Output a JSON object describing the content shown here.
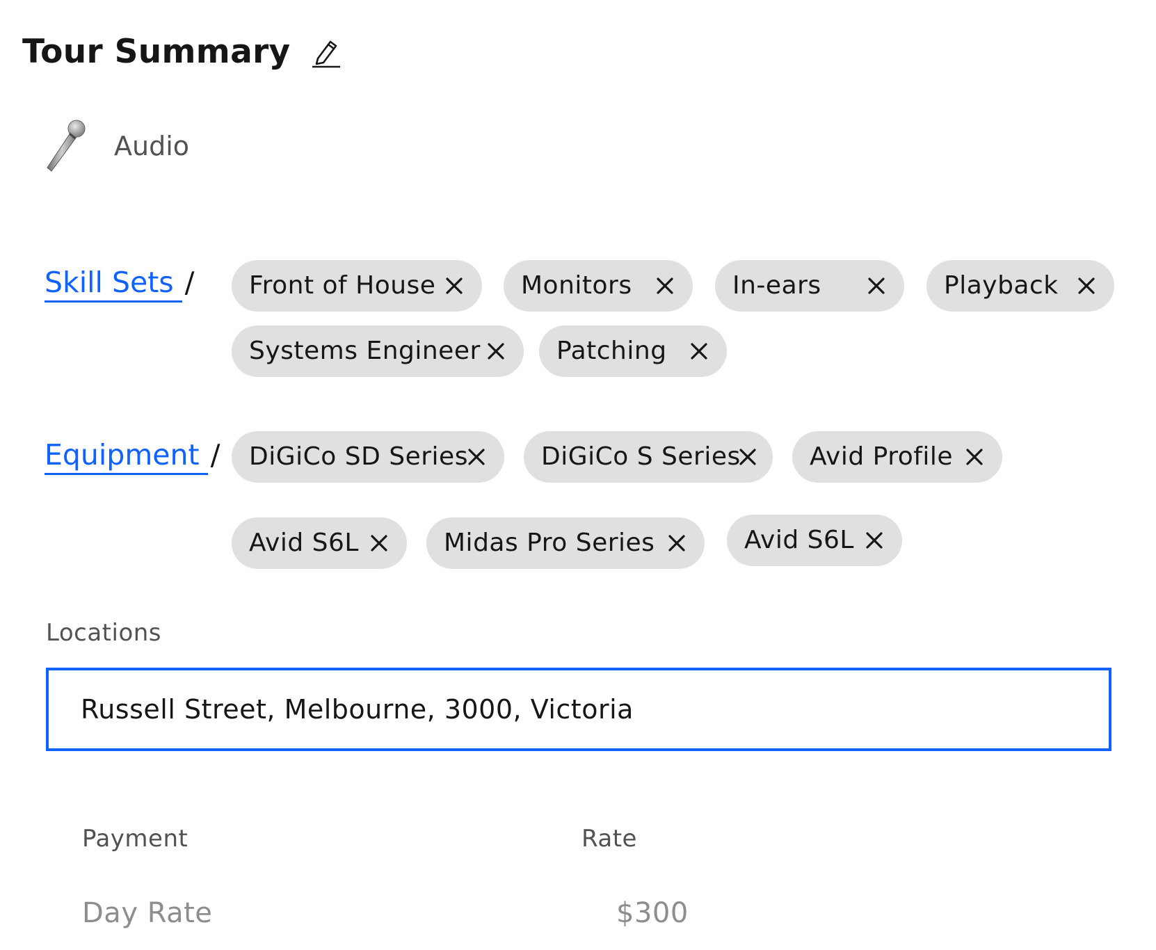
{
  "header": {
    "title": "Tour Summary"
  },
  "category": {
    "label": "Audio",
    "icon": "microphone-icon"
  },
  "skill_sets": {
    "label": "Skill Sets",
    "separator": "/",
    "chips": [
      {
        "label": "Front of House"
      },
      {
        "label": "Monitors"
      },
      {
        "label": "In-ears"
      },
      {
        "label": "Playback"
      },
      {
        "label": "Systems Engineer"
      },
      {
        "label": "Patching"
      }
    ]
  },
  "equipment": {
    "label": "Equipment",
    "separator": "/",
    "chips": [
      {
        "label": "DiGiCo SD Series"
      },
      {
        "label": "DiGiCo S Series"
      },
      {
        "label": "Avid Profile"
      },
      {
        "label": "Avid S6L"
      },
      {
        "label": "Midas Pro Series"
      },
      {
        "label": "Avid S6L"
      }
    ]
  },
  "locations": {
    "label": "Locations",
    "value": "Russell Street, Melbourne, 3000, Victoria"
  },
  "payment_table": {
    "headers": [
      "Payment",
      "Rate"
    ],
    "rows": [
      [
        "Day Rate",
        "$300"
      ]
    ]
  },
  "colors": {
    "accent": "#0f62fe",
    "chip_bg": "#e0e0e0",
    "text": "#161616",
    "muted": "#525252"
  }
}
